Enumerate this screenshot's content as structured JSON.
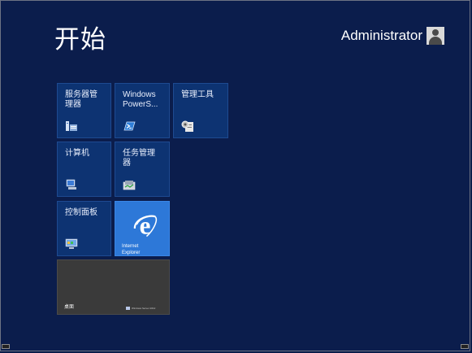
{
  "start": {
    "title": "开始"
  },
  "user": {
    "name": "Administrator"
  },
  "tiles": [
    {
      "label": "服务器管理器",
      "icon": "server-manager-icon"
    },
    {
      "label": "Windows PowerS...",
      "icon": "powershell-icon"
    },
    {
      "label": "管理工具",
      "icon": "admin-tools-icon"
    },
    {
      "label": "计算机",
      "icon": "computer-icon"
    },
    {
      "label": "任务管理器",
      "icon": "task-manager-icon"
    },
    {
      "label": "控制面板",
      "icon": "control-panel-icon"
    },
    {
      "label": "Internet Explorer",
      "line1": "Internet",
      "line2": "Explorer",
      "icon": "internet-explorer-icon"
    },
    {
      "label": "桌面",
      "badge": "Windows Server 2012",
      "icon": "windows-logo-icon"
    }
  ],
  "colors": {
    "background": "#0b1d4c",
    "tile": "#0d3372",
    "ie_tile": "#2d78d8",
    "desktop_tile": "#3a3a3a"
  }
}
